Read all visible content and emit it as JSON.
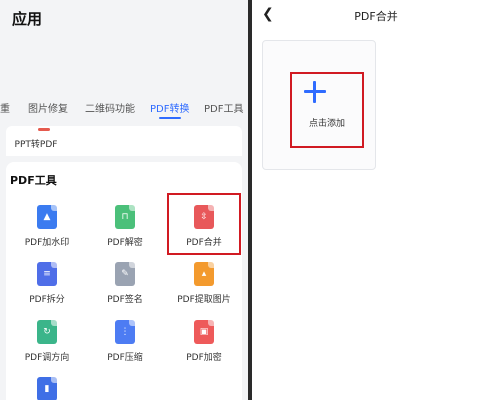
{
  "left": {
    "app_title": "应用",
    "tabs": [
      {
        "label": "重"
      },
      {
        "label": "图片修复"
      },
      {
        "label": "二维码功能"
      },
      {
        "label": "PDF转换",
        "active": true
      },
      {
        "label": "PDF工具"
      }
    ],
    "ppt_item": "PPT转PDF",
    "section_title": "PDF工具",
    "tools": [
      {
        "label": "PDF加水印",
        "icon": "watermark-icon",
        "color": "#3b7bf0"
      },
      {
        "label": "PDF解密",
        "icon": "unlock-icon",
        "color": "#4bc07a"
      },
      {
        "label": "PDF合并",
        "icon": "merge-icon",
        "color": "#e8585a"
      },
      {
        "label": "PDF拆分",
        "icon": "split-icon",
        "color": "#4f6ee8"
      },
      {
        "label": "PDF签名",
        "icon": "signature-icon",
        "color": "#9aa3b2"
      },
      {
        "label": "PDF提取图片",
        "icon": "image-extract-icon",
        "color": "#f39a2e"
      },
      {
        "label": "PDF调方向",
        "icon": "rotate-icon",
        "color": "#3bb58a"
      },
      {
        "label": "PDF压缩",
        "icon": "compress-icon",
        "color": "#4d7cf3"
      },
      {
        "label": "PDF加密",
        "icon": "lock-icon",
        "color": "#ee5a5a"
      },
      {
        "label": "",
        "icon": "chart-icon",
        "color": "#3f6fe6"
      }
    ]
  },
  "right": {
    "title": "PDF合并",
    "add_label": "点击添加"
  },
  "colors": {
    "accent": "#2f6bff",
    "highlight": "#d11a22"
  }
}
